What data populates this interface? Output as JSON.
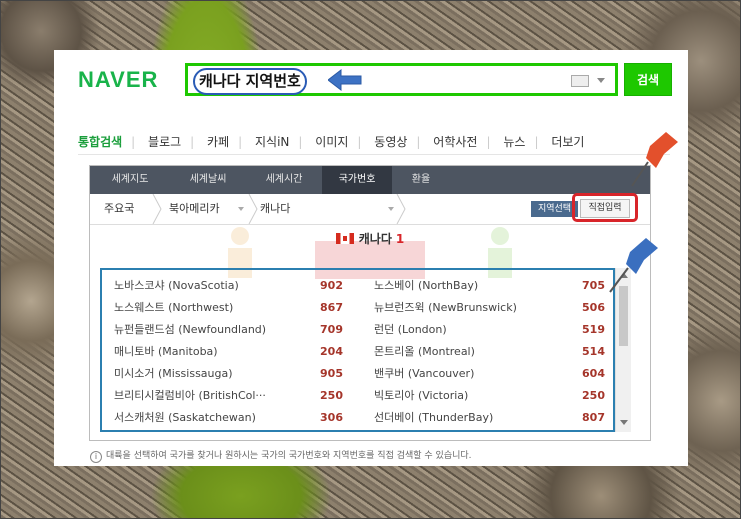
{
  "logo": "NAVER",
  "search": {
    "query": "캐나다 지역번호",
    "button_label": "검색"
  },
  "nav": {
    "items": [
      "통합검색",
      "블로그",
      "카페",
      "지식iN",
      "이미지",
      "동영상",
      "어학사전",
      "뉴스",
      "더보기"
    ],
    "active_index": 0
  },
  "tabs": {
    "items": [
      "세계지도",
      "세계날씨",
      "세계시간",
      "국가번호",
      "환율"
    ],
    "active_index": 3
  },
  "breadcrumb": {
    "items": [
      "주요국",
      "북아메리카",
      "캐나다"
    ],
    "region_select_label": "지역선택",
    "direct_input_label": "직접입력"
  },
  "country": {
    "name": "캐나다",
    "code": "1"
  },
  "regions": [
    {
      "name": "노바스코샤 (NovaScotia)",
      "code": "902"
    },
    {
      "name": "노스베이 (NorthBay)",
      "code": "705"
    },
    {
      "name": "노스웨스트 (Northwest)",
      "code": "867"
    },
    {
      "name": "뉴브런즈윅 (NewBrunswick)",
      "code": "506"
    },
    {
      "name": "뉴펀들랜드섬 (Newfoundland)",
      "code": "709"
    },
    {
      "name": "런던 (London)",
      "code": "519"
    },
    {
      "name": "매니토바 (Manitoba)",
      "code": "204"
    },
    {
      "name": "몬트리올 (Montreal)",
      "code": "514"
    },
    {
      "name": "미시소거 (Mississauga)",
      "code": "905"
    },
    {
      "name": "밴쿠버 (Vancouver)",
      "code": "604"
    },
    {
      "name": "브리티시컬럼비아 (BritishCol···",
      "code": "250"
    },
    {
      "name": "빅토리아 (Victoria)",
      "code": "250"
    },
    {
      "name": "서스캐처원 (Saskatchewan)",
      "code": "306"
    },
    {
      "name": "선더베이 (ThunderBay)",
      "code": "807"
    }
  ],
  "note": "대륙을 선택하여 국가를 찾거나 원하시는 국가의 국가번호와 지역번호를 직접 검색할 수 있습니다.",
  "colors": {
    "brand": "#1ec800",
    "highlight_box": "#d8252a",
    "list_border": "#2b7fb0"
  }
}
